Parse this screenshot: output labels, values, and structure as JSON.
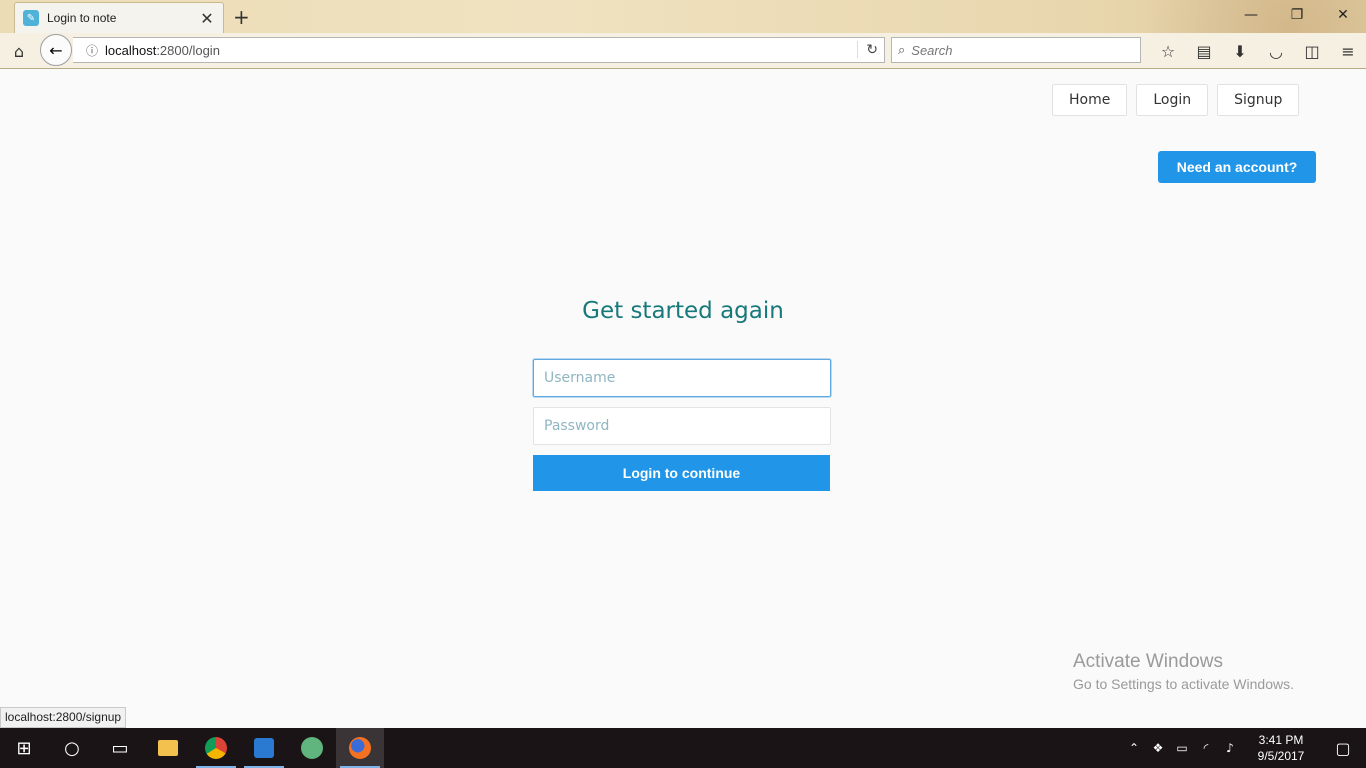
{
  "browser": {
    "tab_title": "Login to note",
    "url_host": "localhost",
    "url_path": ":2800/login",
    "search_placeholder": "Search",
    "status_url": "localhost:2800/signup"
  },
  "nav": {
    "home": "Home",
    "login": "Login",
    "signup": "Signup",
    "need_account": "Need an account?"
  },
  "form": {
    "heading": "Get started again",
    "username_placeholder": "Username",
    "password_placeholder": "Password",
    "submit": "Login to continue"
  },
  "watermark": {
    "line1": "Activate Windows",
    "line2": "Go to Settings to activate Windows."
  },
  "taskbar": {
    "time": "3:41 PM",
    "date": "9/5/2017"
  },
  "colors": {
    "accent": "#2196e9",
    "heading": "#17797a"
  }
}
